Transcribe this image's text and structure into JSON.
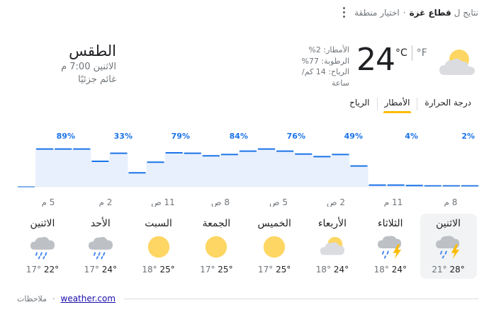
{
  "top": {
    "prefix": "نتايج ل",
    "location": "قطاع غزة",
    "separator": "·",
    "choose_region": "اختيار منطقة"
  },
  "header": {
    "title": "الطقس",
    "time": "الاثنين 7:00 م",
    "condition": "غائم جزئيًا",
    "precip": "الأمطار: 2%",
    "humidity": "الرطوبة: 77%",
    "wind": "الرياح: 14 كم/ساعة",
    "temp": "24",
    "unit_c": "°C",
    "unit_f": "°F",
    "icon": "partly-cloudy-icon"
  },
  "tabs": [
    {
      "label": "درجة الحرارة",
      "active": false
    },
    {
      "label": "الأمطار",
      "active": true
    },
    {
      "label": "الرياح",
      "active": false
    }
  ],
  "chart_data": {
    "type": "area",
    "ylim": [
      0,
      100
    ],
    "step_labels_pct": [
      89,
      33,
      79,
      84,
      76,
      49,
      4,
      2
    ],
    "time_labels": [
      "5 م",
      "2 م",
      "11 ص",
      "8 ص",
      "5 ص",
      "2 ص",
      "11 م",
      "8 م"
    ],
    "values": [
      0,
      89,
      89,
      89,
      60,
      79,
      33,
      58,
      80,
      79,
      73,
      76,
      84,
      89,
      84,
      77,
      71,
      76,
      49,
      4,
      4,
      3,
      2,
      2,
      2
    ],
    "colors": {
      "line": "#1a73e8",
      "fill": "#e8f0fe",
      "label": "#1a73e8"
    }
  },
  "days": [
    {
      "name": "الاثنين",
      "hi": "22°",
      "lo": "17°",
      "icon": "rain-cloud-icon",
      "selected": false
    },
    {
      "name": "الأحد",
      "hi": "24°",
      "lo": "17°",
      "icon": "rain-cloud-icon",
      "selected": false
    },
    {
      "name": "السبت",
      "hi": "25°",
      "lo": "18°",
      "icon": "sun-icon",
      "selected": false
    },
    {
      "name": "الجمعة",
      "hi": "25°",
      "lo": "17°",
      "icon": "sun-icon",
      "selected": false
    },
    {
      "name": "الخميس",
      "hi": "25°",
      "lo": "17°",
      "icon": "sun-icon",
      "selected": false
    },
    {
      "name": "الأربعاء",
      "hi": "24°",
      "lo": "18°",
      "icon": "partly-cloudy-icon",
      "selected": false
    },
    {
      "name": "الثلاثاء",
      "hi": "24°",
      "lo": "18°",
      "icon": "thunderstorm-icon",
      "selected": false
    },
    {
      "name": "الاثنين",
      "hi": "28°",
      "lo": "21°",
      "icon": "thunderstorm-icon",
      "selected": true
    }
  ],
  "footer": {
    "source": "weather.com",
    "separator": "·",
    "notes": "ملاحظات"
  }
}
